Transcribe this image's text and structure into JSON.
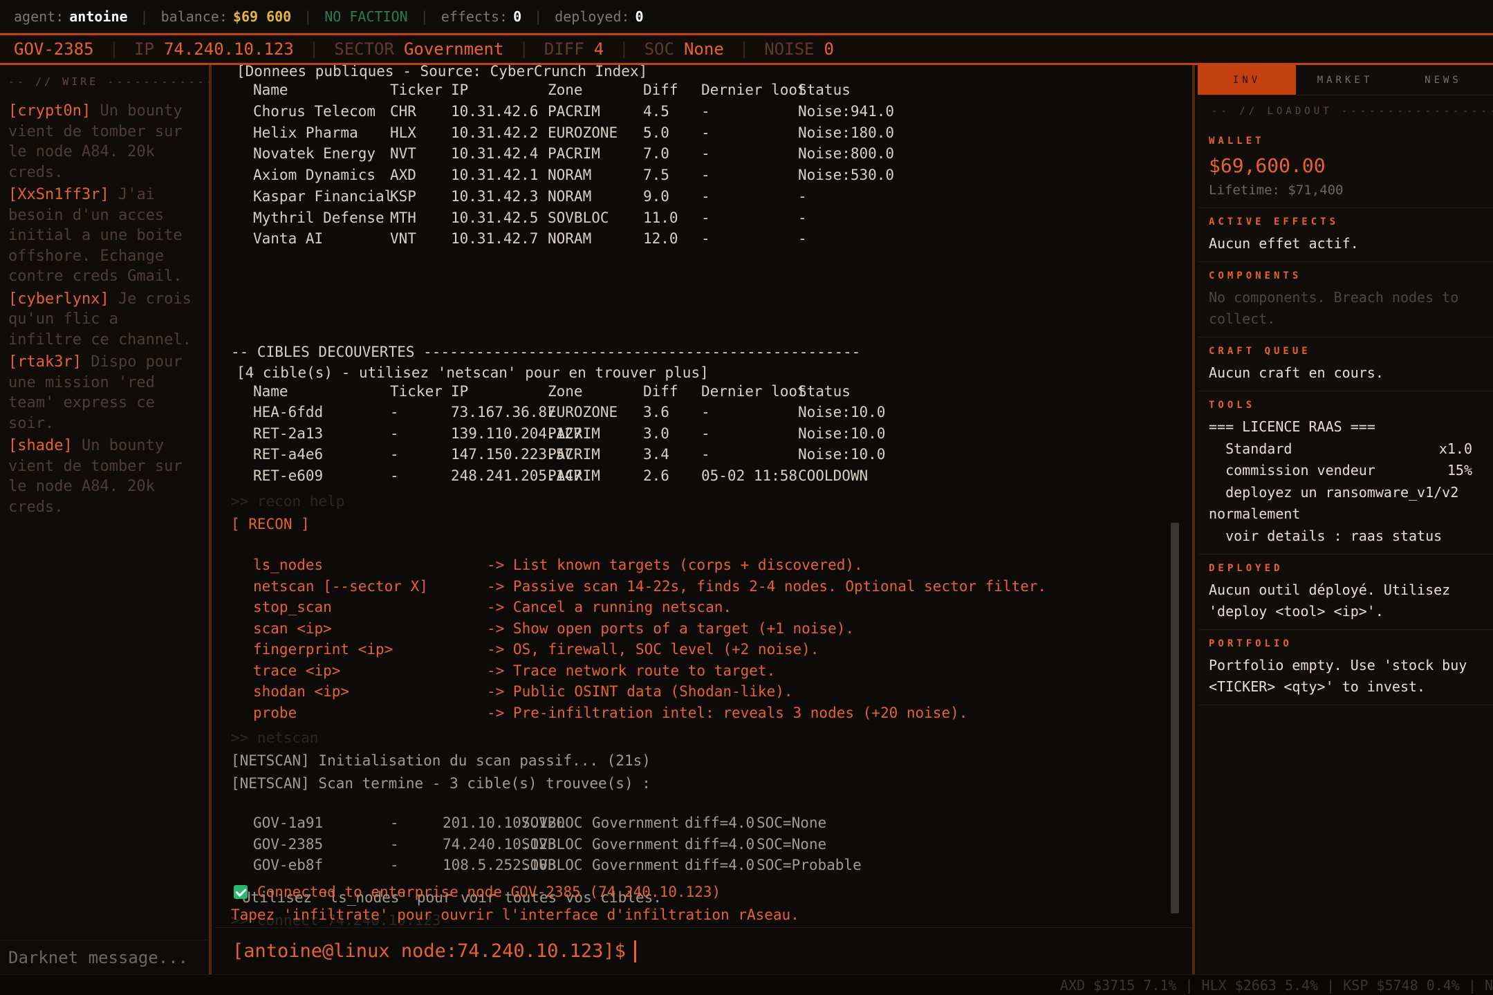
{
  "topbar": {
    "agent_label": "agent:",
    "agent_value": "antoine",
    "balance_label": "balance:",
    "balance_value": "$69 600",
    "faction": "NO FACTION",
    "effects_label": "effects:",
    "effects_value": "0",
    "deployed_label": "deployed:",
    "deployed_value": "0",
    "separator": "|"
  },
  "nodebar": {
    "node_id": "GOV-2385",
    "ip_label": "IP",
    "ip_value": "74.240.10.123",
    "sector_label": "SECTOR",
    "sector_value": "Government",
    "diff_label": "DIFF",
    "diff_value": "4",
    "soc_label": "SOC",
    "soc_value": "None",
    "noise_label": "NOISE",
    "noise_value": "0",
    "separator": "|"
  },
  "wire": {
    "header": "-- // WIRE ---------------------",
    "messages": [
      {
        "who": "[crypt0n]",
        "text": " Un bounty vient de tomber sur le node A84. 20k creds."
      },
      {
        "who": "[XxSn1ff3r]",
        "text": " J'ai besoin d'un acces initial a une boite offshore. Echange contre creds Gmail."
      },
      {
        "who": "[cyberlynx]",
        "text": " Je crois qu'un flic a infiltre ce channel."
      },
      {
        "who": "[rtak3r]",
        "text": " Dispo pour une mission 'red team' express ce soir."
      },
      {
        "who": "[shade]",
        "text": " Un bounty vient de tomber sur le node A84. 20k creds."
      }
    ],
    "input_placeholder": "Darknet message..."
  },
  "terminal": {
    "public_header": "[Donnees publiques - Source: CyberCrunch Index]",
    "columns": [
      "Name",
      "Ticker",
      "IP",
      "Zone",
      "Diff",
      "Dernier loot",
      "Status"
    ],
    "public_rows": [
      [
        "Chorus Telecom",
        "CHR",
        "10.31.42.6",
        "PACRIM",
        "4.5",
        "-",
        "Noise:941.0"
      ],
      [
        "Helix Pharma",
        "HLX",
        "10.31.42.2",
        "EUROZONE",
        "5.0",
        "-",
        "Noise:180.0"
      ],
      [
        "Novatek Energy",
        "NVT",
        "10.31.42.4",
        "PACRIM",
        "7.0",
        "-",
        "Noise:800.0"
      ],
      [
        "Axiom Dynamics",
        "AXD",
        "10.31.42.1",
        "NORAM",
        "7.5",
        "-",
        "Noise:530.0"
      ],
      [
        "Kaspar Financial",
        "KSP",
        "10.31.42.3",
        "NORAM",
        "9.0",
        "-",
        "-"
      ],
      [
        "Mythril Defense",
        "MTH",
        "10.31.42.5",
        "SOVBLOC",
        "11.0",
        "-",
        "-"
      ],
      [
        "Vanta AI",
        "VNT",
        "10.31.42.7",
        "NORAM",
        "12.0",
        "-",
        "-"
      ]
    ],
    "discovered_header": "-- CIBLES DECOUVERTES --------------------------------------------------",
    "discovered_sub": "[4 cible(s) - utilisez 'netscan' pour en trouver plus]",
    "discovered_rows": [
      [
        "HEA-6fdd",
        "-",
        "73.167.36.87",
        "EUROZONE",
        "3.6",
        "-",
        "Noise:10.0"
      ],
      [
        "RET-2a13",
        "-",
        "139.110.204.127",
        "PACRIM",
        "3.0",
        "-",
        "Noise:10.0"
      ],
      [
        "RET-a4e6",
        "-",
        "147.150.223.57",
        "PACRIM",
        "3.4",
        "-",
        "Noise:10.0"
      ],
      [
        "RET-e609",
        "-",
        "248.241.205.147",
        "PACRIM",
        "2.6",
        "05-02 11:58",
        "COOLDOWN"
      ]
    ],
    "cmd_recon_help": ">> recon help",
    "recon_title": "[ RECON ]",
    "recon_cmds": [
      [
        "ls_nodes",
        "-> List known targets (corps + discovered)."
      ],
      [
        "netscan [--sector X]",
        "-> Passive scan 14-22s, finds 2-4 nodes. Optional sector filter."
      ],
      [
        "stop_scan",
        "-> Cancel a running netscan."
      ],
      [
        "scan <ip>",
        "-> Show open ports of a target (+1 noise)."
      ],
      [
        "fingerprint <ip>",
        "-> OS, firewall, SOC level (+2 noise)."
      ],
      [
        "trace <ip>",
        "-> Trace network route to target."
      ],
      [
        "shodan <ip>",
        "-> Public OSINT data (Shodan-like)."
      ],
      [
        "probe",
        "-> Pre-infiltration intel: reveals 3 nodes (+20 noise)."
      ]
    ],
    "cmd_netscan": ">> netscan",
    "netscan_init": "[NETSCAN] Initialisation du scan passif... (21s)",
    "netscan_done": "[NETSCAN] Scan termine - 3 cible(s) trouvee(s) :",
    "netscan_rows": [
      [
        "GOV-1a91",
        "-",
        "201.10.107.120",
        "SOVBLOC",
        "Government",
        "diff=4.0",
        "SOC=None"
      ],
      [
        "GOV-2385",
        "-",
        "74.240.10.123",
        "SOVBLOC",
        "Government",
        "diff=4.0",
        "SOC=None"
      ],
      [
        "GOV-eb8f",
        "-",
        "108.5.252.103",
        "SOVBLOC",
        "Government",
        "diff=4.0",
        "SOC=Probable"
      ]
    ],
    "netscan_hint": "Utilisez 'ls_nodes' pour voir toutes vos cibles.",
    "cmd_connect": ">> connect 74.240.10.123",
    "connected": "Connected to enterprise node GOV-2385 (74.240.10.123)",
    "infiltrate_hint": "Tapez 'infiltrate' pour ouvrir l'interface d'infiltration rAseau.",
    "prompt": "[antoine@linux node:74.240.10.123]$"
  },
  "panel": {
    "tabs": [
      "INV",
      "MARKET",
      "NEWS"
    ],
    "loadout_header": "-- // LOADOUT -----------------------",
    "wallet_title": "WALLET",
    "wallet_amount": "$69,600.00",
    "wallet_lifetime": "Lifetime: $71,400",
    "effects_title": "ACTIVE EFFECTS",
    "effects_text": "Aucun effet actif.",
    "components_title": "COMPONENTS",
    "components_text": "No components. Breach nodes to collect.",
    "craft_title": "CRAFT QUEUE",
    "craft_text": "Aucun craft en cours.",
    "tools_title": "TOOLS",
    "tools_heading": "=== LICENCE RAAS ===",
    "tools_standard": "  Standard",
    "tools_standard_val": "x1.0",
    "tools_commission": "  commission vendeur",
    "tools_commission_val": "15%",
    "tools_deploy": "  deployez un ransomware_v1/v2",
    "tools_normal": "normalement",
    "tools_details": "  voir details : raas status",
    "deployed_title": "DEPLOYED",
    "deployed_text": "Aucun outil déployé. Utilisez 'deploy <tool> <ip>'.",
    "portfolio_title": "PORTFOLIO",
    "portfolio_text": "Portfolio empty. Use 'stock buy <TICKER> <qty>' to invest."
  },
  "ticker": {
    "text": "AXD $3715 7.1% | HLX $2663 5.4% | KSP $5748 0.4% | N"
  },
  "colors": {
    "accent": "#e8622a",
    "accent_dark": "#c4410f",
    "ok": "#2bb673",
    "gold": "#e8b440",
    "faction_green": "#2f7a4f"
  }
}
